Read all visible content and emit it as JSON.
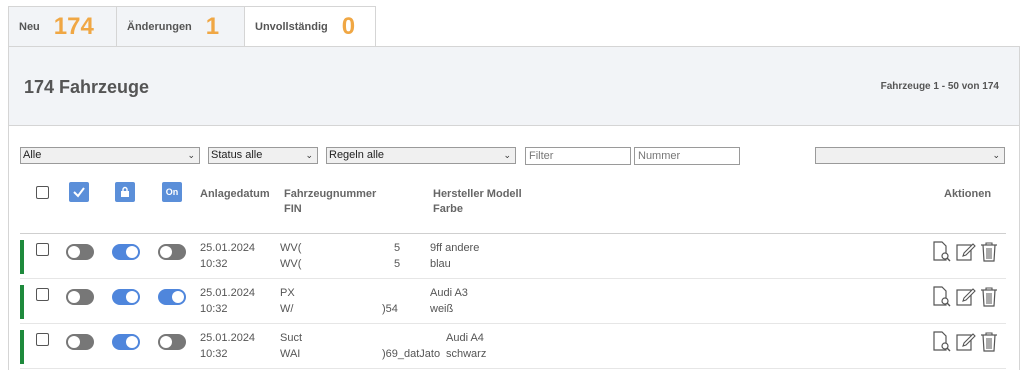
{
  "tabs": [
    {
      "label": "Neu",
      "count": "174"
    },
    {
      "label": "Änderungen",
      "count": "1"
    },
    {
      "label": "Unvollständig",
      "count": "0"
    }
  ],
  "panel": {
    "title": "174 Fahrzeuge",
    "range": "Fahrzeuge 1 - 50 von 174"
  },
  "filters": {
    "type_select": "Alle",
    "status_select": "Status alle",
    "rules_select": "Regeln alle",
    "filter_placeholder": "Filter",
    "number_placeholder": "Nummer",
    "extra_select": ""
  },
  "header_icons": {
    "check": "checkmark-icon",
    "lock": "lock-icon",
    "on_label": "On"
  },
  "columns": {
    "date": "Anlagedatum",
    "number": "Fahrzeugnummer",
    "fin": "FIN",
    "model": "Hersteller Modell",
    "color": "Farbe",
    "actions": "Aktionen"
  },
  "rows": [
    {
      "date": "25.01.2024",
      "time": "10:32",
      "num1": "WV(",
      "num1b": "5",
      "num2": "WV(",
      "num2b": "5",
      "model": "9ff andere",
      "color": "blau",
      "t1": "off",
      "t2": "on",
      "t3": "off"
    },
    {
      "date": "25.01.2024",
      "time": "10:32",
      "num1": "PX",
      "num1b": "",
      "num2": "W/",
      "num2b": ")54",
      "model": "Audi A3",
      "color": "weiß",
      "t1": "off",
      "t2": "on",
      "t3": "on"
    },
    {
      "date": "25.01.2024",
      "time": "10:32",
      "num1": "Suct",
      "num1b": "",
      "num2": "WAI",
      "num2b": ")69_datJato",
      "model": "Audi A4",
      "color": "schwarz",
      "t1": "off",
      "t2": "on",
      "t3": "off"
    }
  ],
  "colors": {
    "accent_orange": "#f0a744",
    "toggle_blue": "#4f86dc",
    "status_green": "#1e8a3c"
  }
}
